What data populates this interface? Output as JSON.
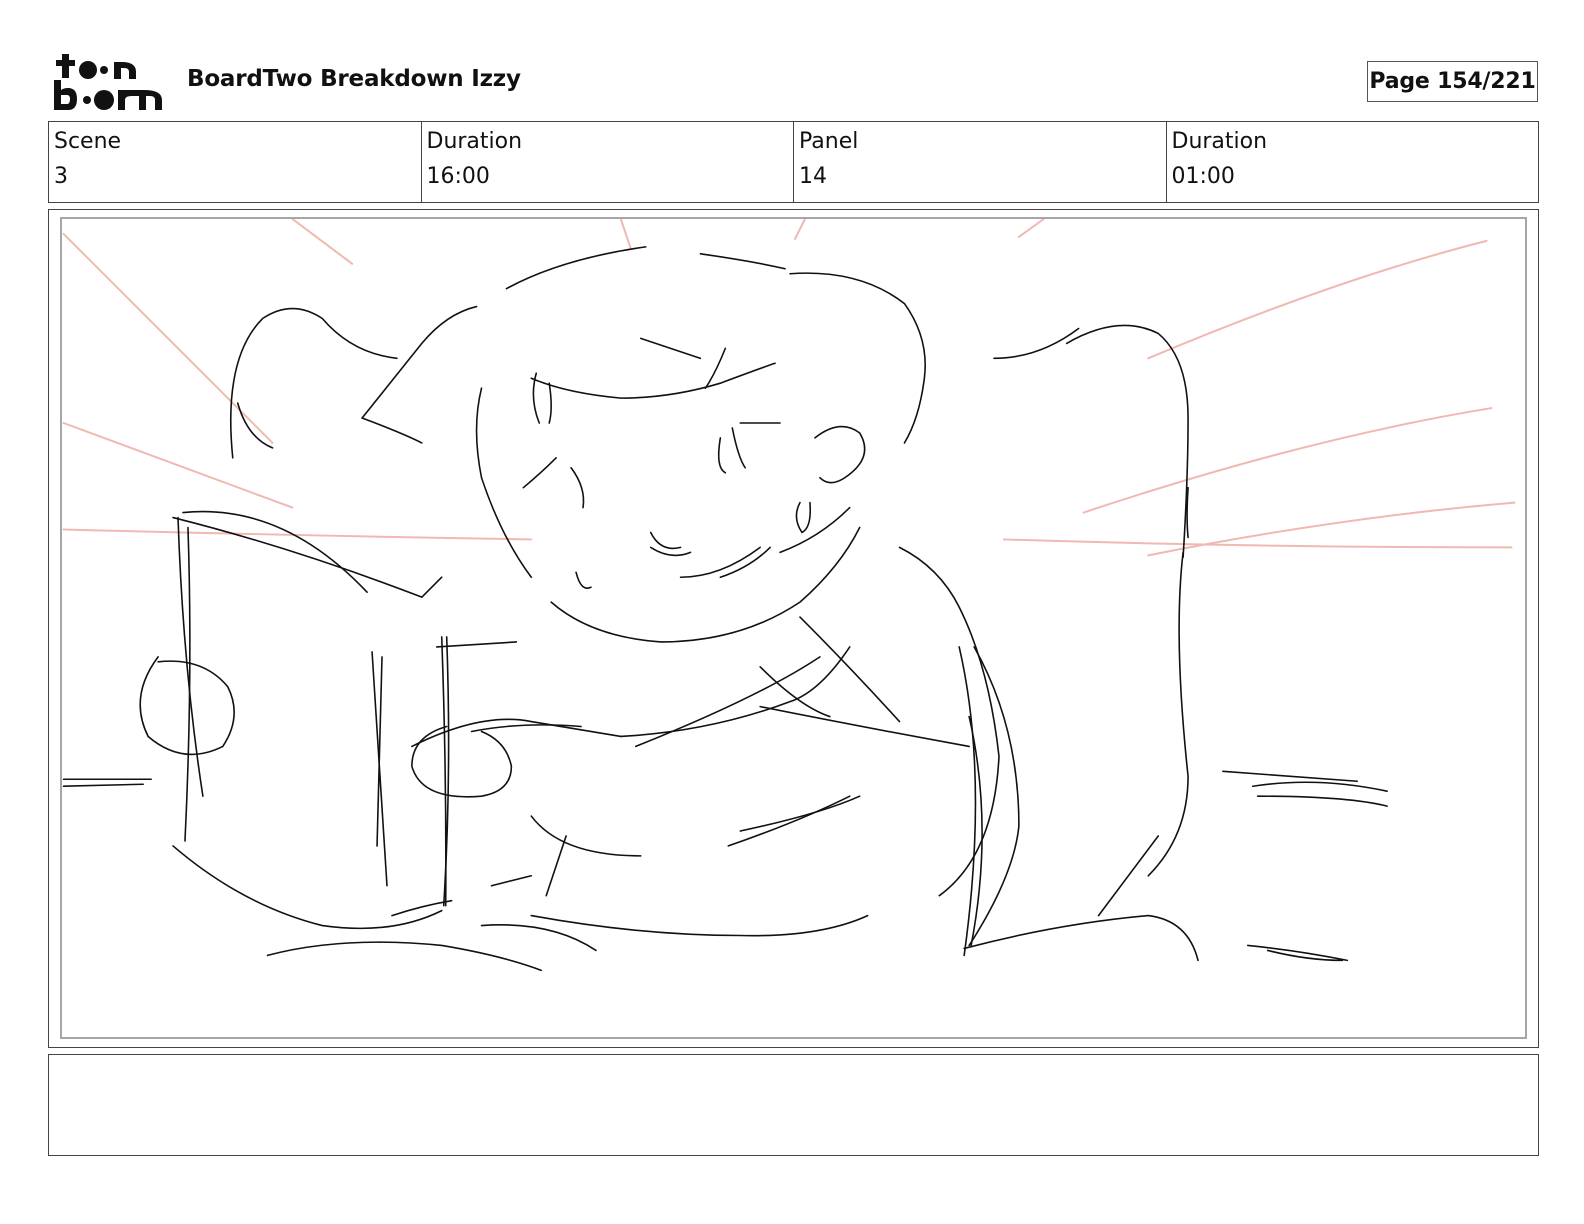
{
  "header": {
    "logo_text": "toon boom",
    "title": "BoardTwo Breakdown Izzy",
    "page_indicator": "Page 154/221"
  },
  "info": [
    {
      "label": "Scene",
      "value": "3"
    },
    {
      "label": "Duration",
      "value": "16:00"
    },
    {
      "label": "Panel",
      "value": "14"
    },
    {
      "label": "Duration",
      "value": "01:00"
    }
  ],
  "panel": {
    "image_name": "storyboard-sketch",
    "sketch_color": "#111111",
    "guide_line_color": "#f0b8b0"
  },
  "notes": {
    "text": ""
  }
}
